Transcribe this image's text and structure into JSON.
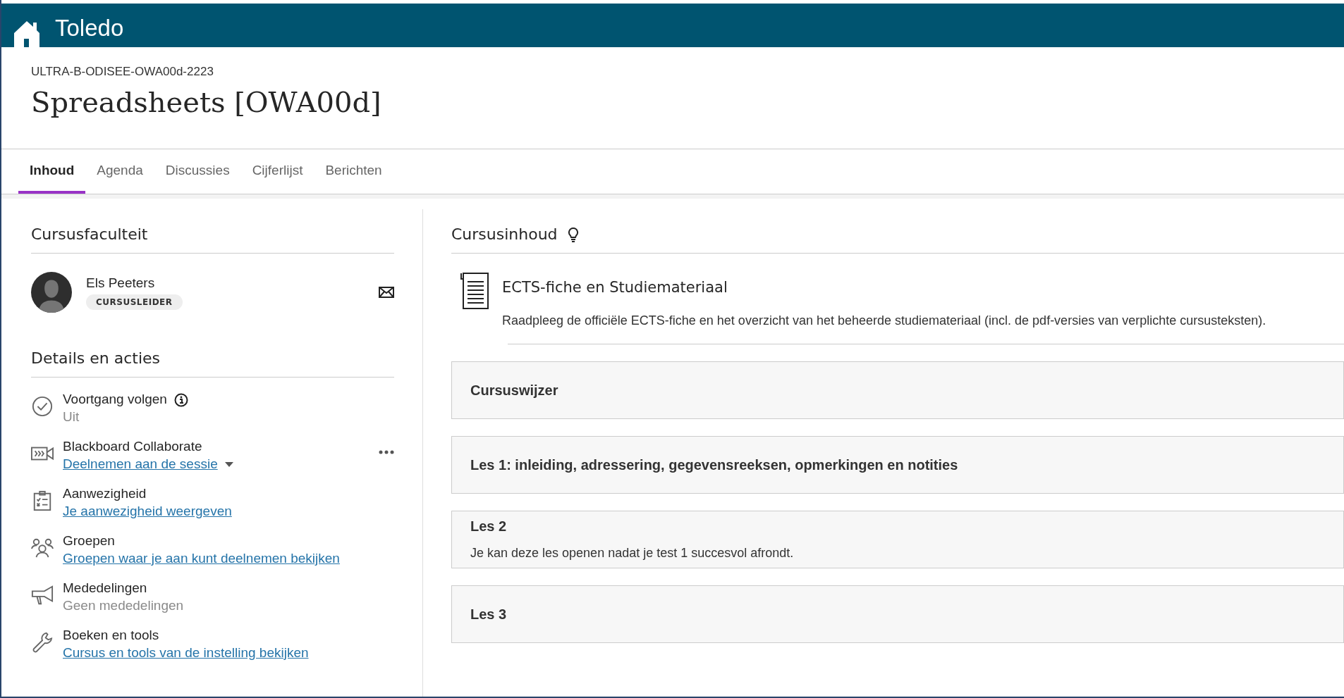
{
  "app": {
    "name": "Toledo"
  },
  "course": {
    "code": "ULTRA-B-ODISEE-OWA00d-2223",
    "title": "Spreadsheets [OWA00d]"
  },
  "tabs": [
    {
      "label": "Inhoud",
      "selected": true
    },
    {
      "label": "Agenda",
      "selected": false
    },
    {
      "label": "Discussies",
      "selected": false
    },
    {
      "label": "Cijferlijst",
      "selected": false
    },
    {
      "label": "Berichten",
      "selected": false
    }
  ],
  "faculty": {
    "heading": "Cursusfaculteit",
    "members": [
      {
        "name": "Els Peeters",
        "role": "CURSUSLEIDER"
      }
    ]
  },
  "details": {
    "heading": "Details en acties",
    "items": [
      {
        "kind": "progress",
        "title": "Voortgang volgen",
        "subtitle": "Uit"
      },
      {
        "kind": "collaborate",
        "title": "Blackboard Collaborate",
        "link": "Deelnemen aan de sessie"
      },
      {
        "kind": "attendance",
        "title": "Aanwezigheid",
        "link": "Je aanwezigheid weergeven"
      },
      {
        "kind": "groups",
        "title": "Groepen",
        "link": "Groepen waar je aan kunt deelnemen bekijken"
      },
      {
        "kind": "announcements",
        "title": "Mededelingen",
        "subtitle": "Geen mededelingen"
      },
      {
        "kind": "tools",
        "title": "Boeken en tools",
        "link": "Cursus en tools van de instelling bekijken"
      }
    ]
  },
  "content": {
    "heading": "Cursusinhoud",
    "document": {
      "title": "ECTS-fiche en Studiemateriaal",
      "description": "Raadpleeg de officiële ECTS-fiche en het overzicht van het beheerde studiemateriaal (incl. de pdf-versies van verplichte cursusteksten)."
    },
    "folders": [
      {
        "title": "Cursuswijzer"
      },
      {
        "title": "Les 1: inleiding, adressering, gegevensreeksen, opmerkingen en notities"
      },
      {
        "title": "Les 2",
        "description": "Je kan deze les openen nadat je test 1 succesvol afrondt."
      },
      {
        "title": "Les 3"
      }
    ]
  }
}
